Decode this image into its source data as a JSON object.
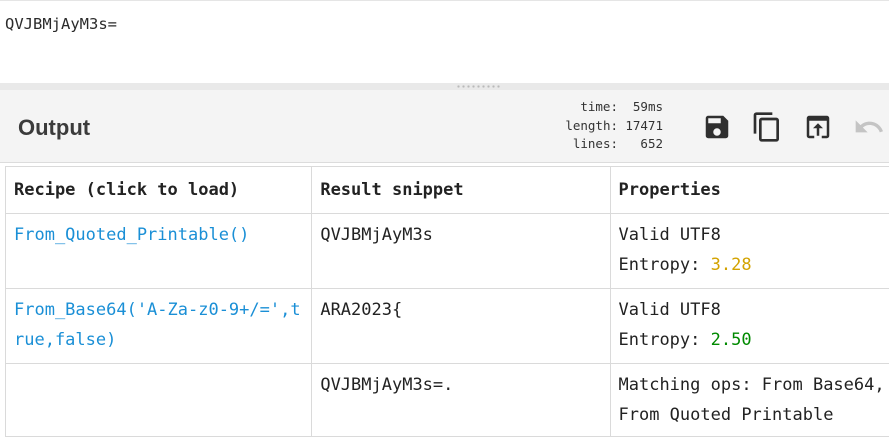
{
  "input": {
    "text": "QVJBMjAyM3s="
  },
  "output": {
    "title": "Output",
    "stats": {
      "time_label": "time:",
      "time_value": "59ms",
      "length_label": "length:",
      "length_value": "17471",
      "lines_label": "lines:",
      "lines_value": "652"
    }
  },
  "toolbar": {
    "save": "save-icon",
    "copy": "copy-icon",
    "replace_input": "move-to-input-icon",
    "undo": "undo-icon"
  },
  "table": {
    "headers": [
      "Recipe (click to load)",
      "Result snippet",
      "Properties"
    ],
    "rows": [
      {
        "recipe": "From_Quoted_Printable()",
        "snippet": "QVJBMjAyM3s",
        "prop_line1": "Valid UTF8",
        "entropy_label": "Entropy: ",
        "entropy_value": "3.28"
      },
      {
        "recipe": "From_Base64('A-Za-z0-9+/=',true,false)",
        "snippet": "ARA2023{",
        "prop_line1": "Valid UTF8",
        "entropy_label": "Entropy: ",
        "entropy_value": "2.50"
      },
      {
        "recipe": "",
        "snippet": "QVJBMjAyM3s=.",
        "prop_text": "Matching ops: From Base64, From Quoted Printable"
      }
    ]
  },
  "colors": {
    "link": "#1a8fd6",
    "entropy_mid": "#d3a300",
    "entropy_low": "#008a00"
  }
}
